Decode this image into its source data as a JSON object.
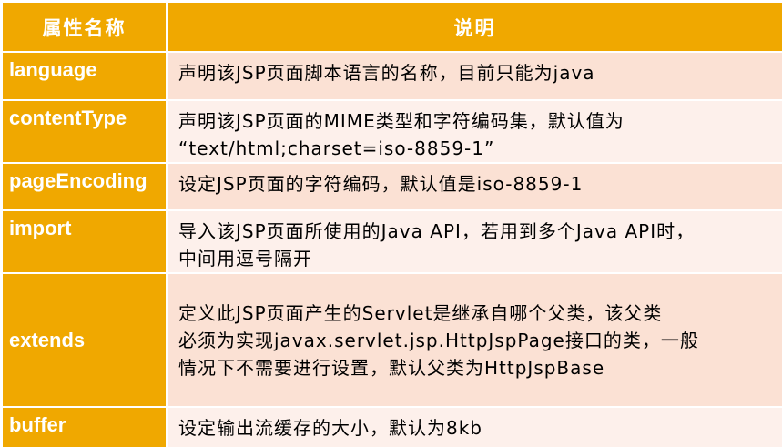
{
  "header": {
    "col_name": "属性名称",
    "col_desc": "说明"
  },
  "rows": [
    {
      "name": "language",
      "desc": [
        "声明该JSP页面脚本语言的名称，目前只能为java"
      ]
    },
    {
      "name": "contentType",
      "desc": [
        "声明该JSP页面的MIME类型和字符编码集，默认值为",
        "“text/html;charset=iso-8859-1”"
      ]
    },
    {
      "name": "pageEncoding",
      "desc": [
        "设定JSP页面的字符编码，默认值是iso-8859-1"
      ]
    },
    {
      "name": "import",
      "desc": [
        "导入该JSP页面所使用的Java API，若用到多个Java API时，",
        "中间用逗号隔开"
      ]
    },
    {
      "name": "extends",
      "desc": [
        "定义此JSP页面产生的Servlet是继承自哪个父类，该父类",
        "必须为实现javax.servlet.jsp.HttpJspPage接口的类，一般",
        "情况下不需要进行设置，默认父类为HttpJspBase"
      ]
    },
    {
      "name": "buffer",
      "desc": [
        "设定输出流缓存的大小，默认为8kb"
      ]
    }
  ],
  "colors": {
    "header_bg": "#f0a800",
    "desc_bg": "#fbe1d4",
    "desc_bg_alt": "#fdf0eb"
  }
}
